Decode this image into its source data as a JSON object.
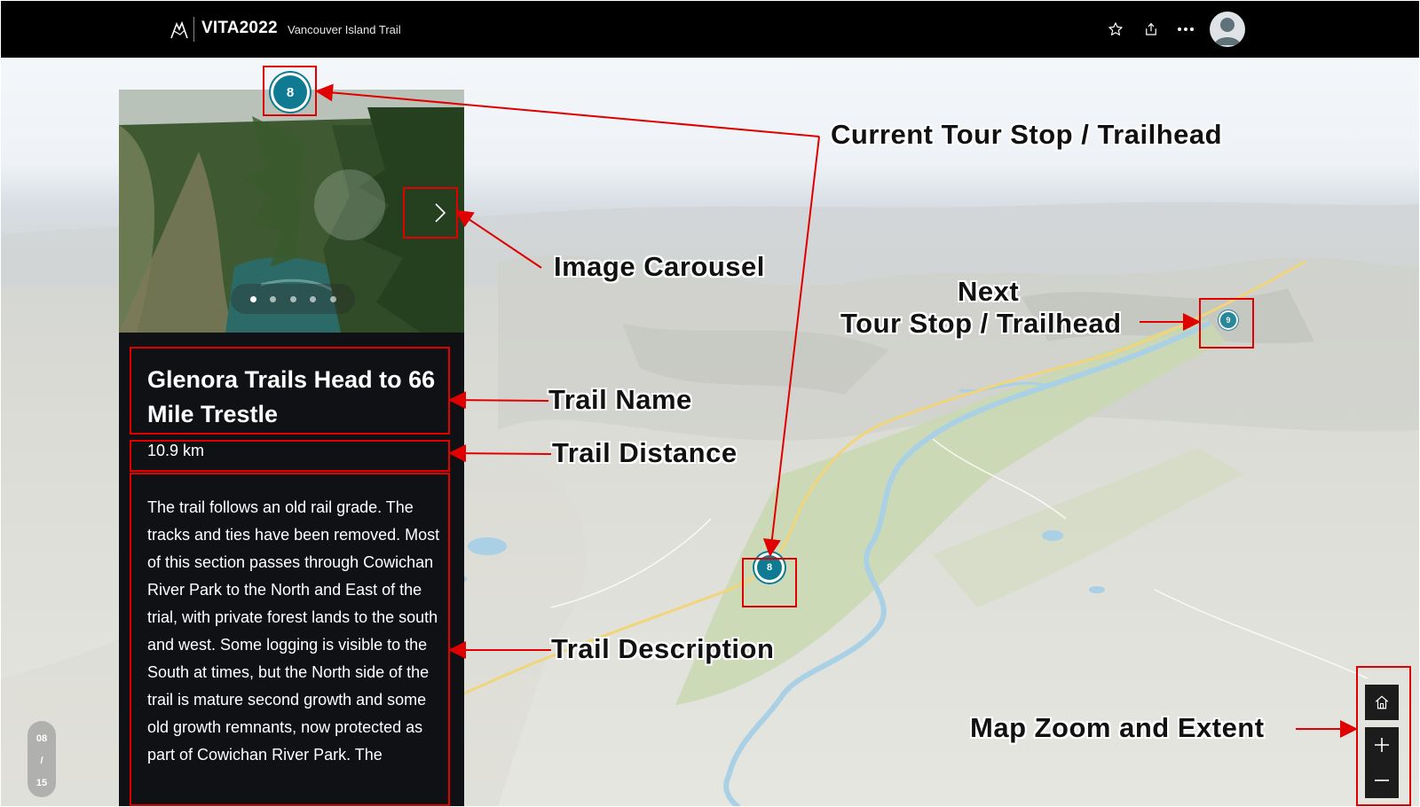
{
  "header": {
    "brand": "VITA2022",
    "subtitle": "Vancouver Island Trail",
    "icons": [
      "star-icon",
      "share-icon",
      "more-icon",
      "avatar"
    ]
  },
  "tour": {
    "current_stop": "8",
    "next_stop": "9",
    "map_stop_label": "8",
    "counter": {
      "current": "08",
      "separator": "/",
      "total": "15"
    }
  },
  "carousel": {
    "image_count": 5,
    "active_index": 0
  },
  "trail": {
    "name": "Glenora Trails Head to 66 Mile Trestle",
    "distance": "10.9 km",
    "description": "The trail follows an old rail grade. The tracks and ties have been removed. Most of this section passes through Cowichan River Park to the North and East of the trial, with private forest lands to the south and west. Some logging is visible to the South at times, but the North side of the trail is mature second growth and some old growth remnants, now protected as part of Cowichan River Park. The"
  },
  "annotations": {
    "current_stop": "Current Tour Stop / Trailhead",
    "image_carousel": "Image Carousel",
    "next_line1": "Next",
    "next_line2": "Tour Stop / Trailhead",
    "trail_name": "Trail Name",
    "trail_distance": "Trail Distance",
    "trail_description": "Trail Description",
    "map_zoom": "Map Zoom and Extent"
  },
  "colors": {
    "header_bg": "#000000",
    "panel_bg": "#0f1114",
    "marker": "#0f7b93",
    "annotation": "#e00000"
  }
}
